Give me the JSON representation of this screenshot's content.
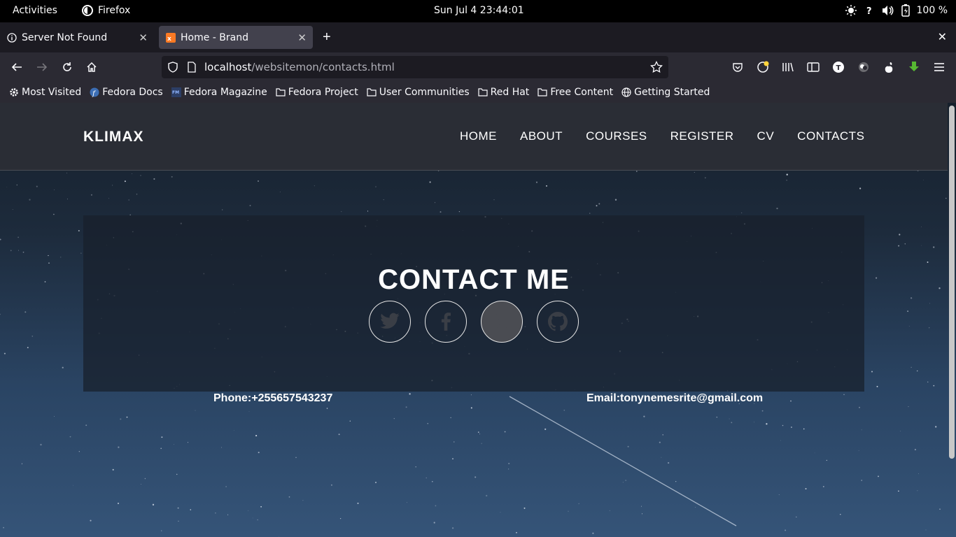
{
  "system": {
    "activities": "Activities",
    "app_name": "Firefox",
    "clock": "Sun Jul 4  23:44:01",
    "battery": "100 %"
  },
  "tabs": [
    {
      "title": "Server Not Found",
      "icon": "info-icon"
    },
    {
      "title": "Home - Brand",
      "icon": "xampp-icon"
    }
  ],
  "urlbar": {
    "host": "localhost",
    "path": "/websitemon/contacts.html"
  },
  "bookmarks": [
    {
      "label": "Most Visited",
      "icon": "gear-icon"
    },
    {
      "label": "Fedora Docs",
      "icon": "fedora-icon"
    },
    {
      "label": "Fedora Magazine",
      "icon": "fm-icon"
    },
    {
      "label": "Fedora Project",
      "icon": "folder-icon"
    },
    {
      "label": "User Communities",
      "icon": "folder-icon"
    },
    {
      "label": "Red Hat",
      "icon": "folder-icon"
    },
    {
      "label": "Free Content",
      "icon": "folder-icon"
    },
    {
      "label": "Getting Started",
      "icon": "globe-icon"
    }
  ],
  "site": {
    "brand": "KLIMAX",
    "nav": [
      "HOME",
      "ABOUT",
      "COURSES",
      "REGISTER",
      "CV",
      "CONTACTS"
    ],
    "contact_title": "CONTACT ME",
    "socials": [
      "twitter-icon",
      "facebook-icon",
      "instagram-icon",
      "github-icon"
    ],
    "phone": "Phone:+255657543237",
    "email": "Email:tonynemesrite@gmail.com"
  }
}
